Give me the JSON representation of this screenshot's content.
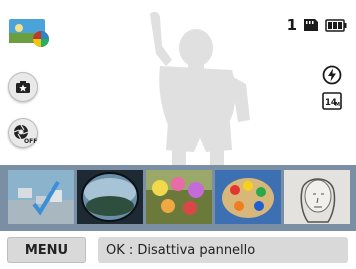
{
  "status": {
    "shots_remaining": "1"
  },
  "bottom_bar": {
    "menu_label": "MENU",
    "ok_hint": "OK : Disattiva pannello"
  },
  "icons": {
    "mode_thumbnail": "smart-filter-mode-icon",
    "left": [
      "camera-star-icon",
      "shutter-off-icon"
    ],
    "status": [
      "memory-card-icon",
      "battery-full-icon"
    ],
    "right": [
      "flash-auto-icon",
      "resolution-14m-icon"
    ]
  },
  "filters": [
    {
      "name": "miniature-filter-thumb",
      "selected": true
    },
    {
      "name": "fisheye-filter-thumb",
      "selected": false
    },
    {
      "name": "flowers-filter-thumb",
      "selected": false
    },
    {
      "name": "palette-filter-thumb",
      "selected": false
    },
    {
      "name": "sketch-portrait-filter-thumb",
      "selected": false
    }
  ],
  "colors": {
    "strip": "#7a8fa3",
    "selection": "#5cb0e6",
    "silhouette": "#e0e0e0"
  }
}
